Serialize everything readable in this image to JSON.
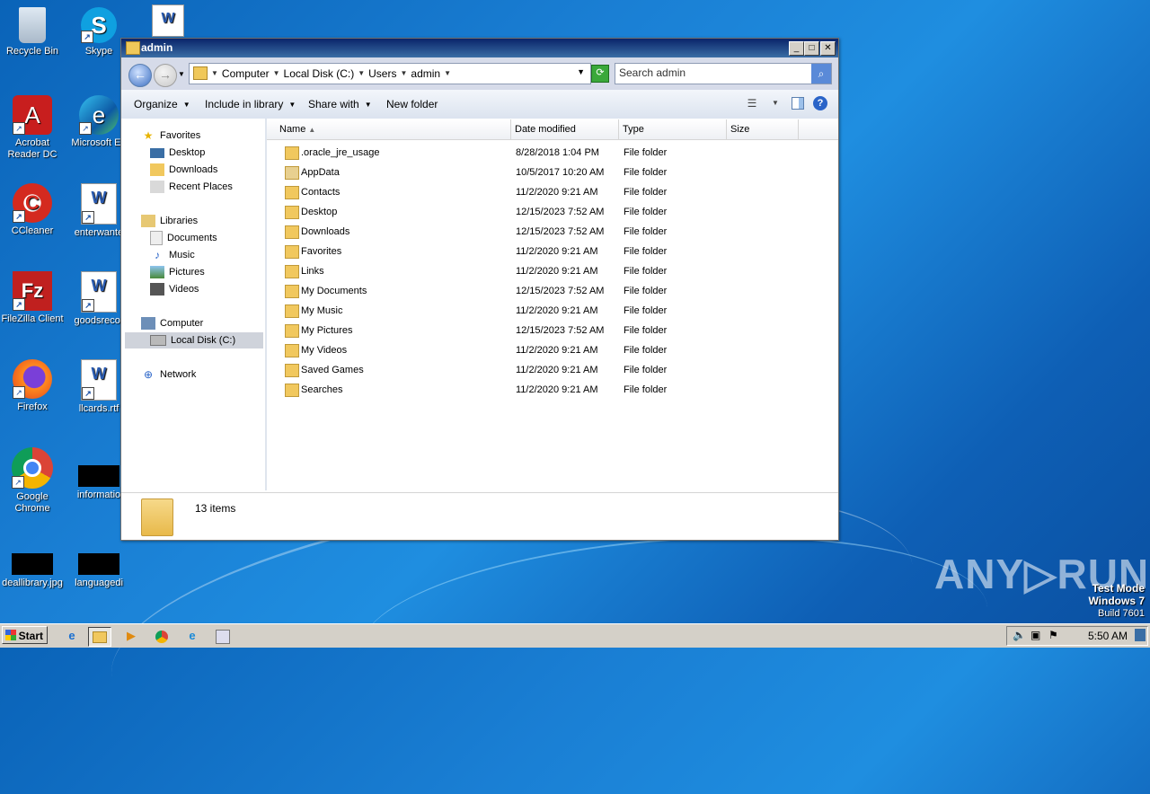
{
  "desktop": {
    "icons": [
      {
        "label": "Recycle Bin",
        "glyph": "🗑"
      },
      {
        "label": "Skype",
        "glyph": "S"
      },
      {
        "label": "",
        "glyph": "W"
      },
      {
        "label": "Acrobat Reader DC",
        "glyph": "A"
      },
      {
        "label": "Microsoft Ed",
        "glyph": "e"
      },
      {
        "label": "CCleaner",
        "glyph": "C"
      },
      {
        "label": "enterwante",
        "glyph": "W"
      },
      {
        "label": "FileZilla Client",
        "glyph": "Fz"
      },
      {
        "label": "goodsrecor",
        "glyph": "W"
      },
      {
        "label": "Firefox",
        "glyph": "🦊"
      },
      {
        "label": "llcards.rtf",
        "glyph": "W"
      },
      {
        "label": "Google Chrome",
        "glyph": "◉"
      },
      {
        "label": "informatio",
        "glyph": ""
      },
      {
        "label": "deallibrary.jpg",
        "glyph": ""
      },
      {
        "label": "languagedi",
        "glyph": ""
      }
    ]
  },
  "window": {
    "title": "admin",
    "controls": {
      "min": "_",
      "max": "□",
      "close": "✕"
    },
    "address": {
      "crumbs": [
        "Computer",
        "Local Disk (C:)",
        "Users",
        "admin"
      ]
    },
    "search": {
      "placeholder": "Search admin"
    },
    "commands": [
      {
        "label": "Organize",
        "dropdown": true
      },
      {
        "label": "Include in library",
        "dropdown": true
      },
      {
        "label": "Share with",
        "dropdown": true
      },
      {
        "label": "New folder",
        "dropdown": false
      }
    ],
    "nav": {
      "favorites": {
        "label": "Favorites",
        "items": [
          "Desktop",
          "Downloads",
          "Recent Places"
        ]
      },
      "libraries": {
        "label": "Libraries",
        "items": [
          "Documents",
          "Music",
          "Pictures",
          "Videos"
        ]
      },
      "computer": {
        "label": "Computer",
        "items": [
          "Local Disk (C:)"
        ]
      },
      "network": {
        "label": "Network"
      }
    },
    "columns": [
      "Name",
      "Date modified",
      "Type",
      "Size"
    ],
    "rows": [
      {
        "name": ".oracle_jre_usage",
        "date": "8/28/2018 1:04 PM",
        "type": "File folder"
      },
      {
        "name": "AppData",
        "date": "10/5/2017 10:20 AM",
        "type": "File folder"
      },
      {
        "name": "Contacts",
        "date": "11/2/2020 9:21 AM",
        "type": "File folder"
      },
      {
        "name": "Desktop",
        "date": "12/15/2023 7:52 AM",
        "type": "File folder"
      },
      {
        "name": "Downloads",
        "date": "12/15/2023 7:52 AM",
        "type": "File folder"
      },
      {
        "name": "Favorites",
        "date": "11/2/2020 9:21 AM",
        "type": "File folder"
      },
      {
        "name": "Links",
        "date": "11/2/2020 9:21 AM",
        "type": "File folder"
      },
      {
        "name": "My Documents",
        "date": "12/15/2023 7:52 AM",
        "type": "File folder"
      },
      {
        "name": "My Music",
        "date": "11/2/2020 9:21 AM",
        "type": "File folder"
      },
      {
        "name": "My Pictures",
        "date": "12/15/2023 7:52 AM",
        "type": "File folder"
      },
      {
        "name": "My Videos",
        "date": "11/2/2020 9:21 AM",
        "type": "File folder"
      },
      {
        "name": "Saved Games",
        "date": "11/2/2020 9:21 AM",
        "type": "File folder"
      },
      {
        "name": "Searches",
        "date": "11/2/2020 9:21 AM",
        "type": "File folder"
      }
    ],
    "status": {
      "count": "13 items"
    }
  },
  "watermark": {
    "brand": "ANY▷RUN",
    "mode": "Test Mode",
    "os": "Windows 7",
    "build": "Build 7601"
  },
  "taskbar": {
    "start": "Start",
    "clock": "5:50 AM"
  }
}
